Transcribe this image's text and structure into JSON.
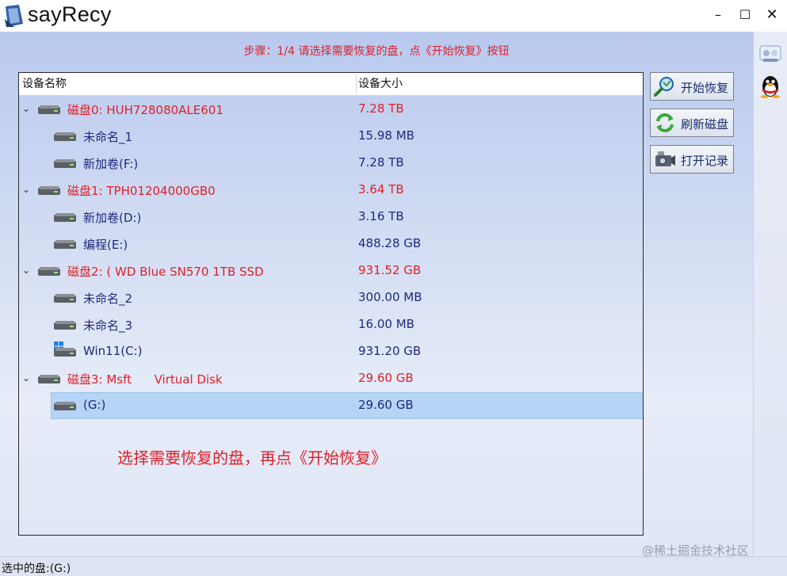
{
  "window": {
    "title": "sayRecy",
    "minimize": "–",
    "maximize": "☐",
    "close": "✕"
  },
  "step_text": "步骤：1/4 请选择需要恢复的盘，点《开始恢复》按钮",
  "columns": {
    "name": "设备名称",
    "size": "设备大小"
  },
  "rows": [
    {
      "name": "磁盘0: HUH728080ALE601",
      "size": "7.28 TB"
    },
    {
      "name": "未命名_1",
      "size": "15.98 MB"
    },
    {
      "name": "新加卷(F:)",
      "size": "7.28 TB"
    },
    {
      "name": "磁盘1: TPH01204000GB0",
      "size": "3.64 TB"
    },
    {
      "name": "新加卷(D:)",
      "size": "3.16 TB"
    },
    {
      "name": "编程(E:)",
      "size": "488.28 GB"
    },
    {
      "name": "磁盘2: ( WD Blue SN570 1TB SSD",
      "size": "931.52 GB"
    },
    {
      "name": "未命名_2",
      "size": "300.00 MB"
    },
    {
      "name": "未命名_3",
      "size": "16.00 MB"
    },
    {
      "name": "Win11(C:)",
      "size": "931.20 GB"
    },
    {
      "name": "磁盘3: Msft      Virtual Disk",
      "size": "29.60 GB"
    },
    {
      "name": "(G:)",
      "size": "29.60 GB"
    }
  ],
  "hint": "选择需要恢复的盘，再点《开始恢复》",
  "buttons": {
    "start": "开始恢复",
    "refresh": "刷新磁盘",
    "log": "打开记录"
  },
  "status": "选中的盘:(G:)",
  "watermark": "@稀土掘金技术社区",
  "colors": {
    "disk_text": "#e0202a",
    "partition_text": "#1e2a7a",
    "selection": "#b6d4f5"
  }
}
